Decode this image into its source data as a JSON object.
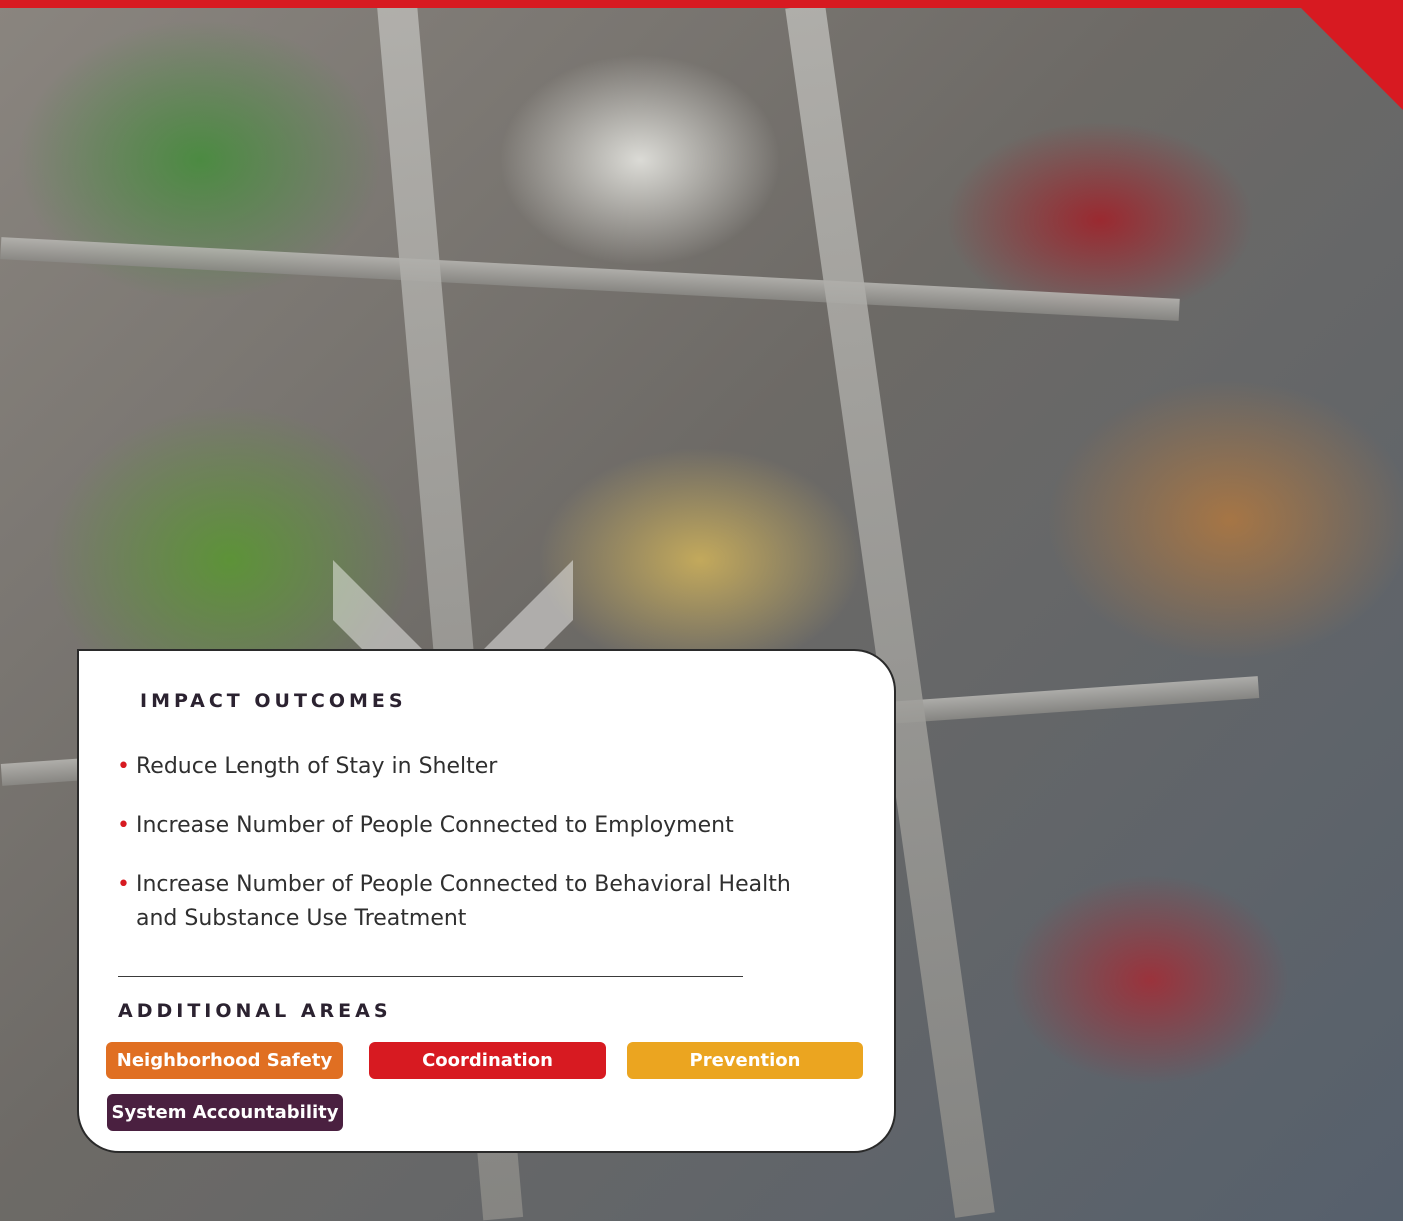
{
  "section_title": "IMPACT OUTCOMES",
  "outcomes": [
    "Reduce Length of Stay in Shelter",
    "Increase Number of People Connected to Employment",
    "Increase Number of People Connected to Behavioral Health and Substance Use Treatment"
  ],
  "additional_title": "ADDITIONAL AREAS",
  "tags": [
    {
      "label": "Neighborhood Safety",
      "color": "#e06f22"
    },
    {
      "label": "Coordination",
      "color": "#d71a21"
    },
    {
      "label": "Prevention",
      "color": "#eba520"
    },
    {
      "label": "System Accountability",
      "color": "#4a2040"
    }
  ],
  "colors": {
    "brand_red": "#d71a21",
    "bullet": "#d71a21",
    "text": "#2f2f2f",
    "heading": "#2b2230"
  },
  "icons": {
    "chevron": "chevron-down-icon"
  }
}
